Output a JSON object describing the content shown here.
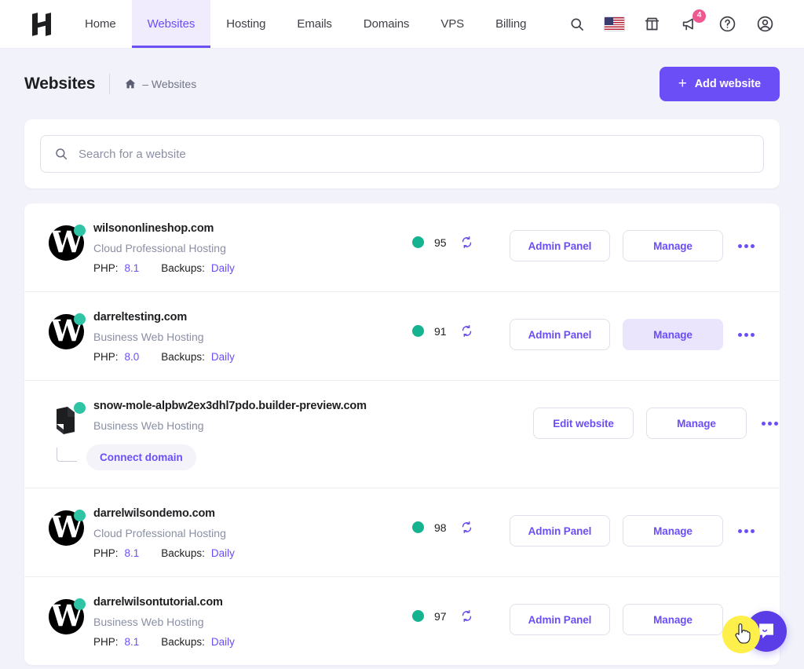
{
  "nav": {
    "logo_name": "hostinger-logo",
    "items": [
      {
        "label": "Home",
        "active": false
      },
      {
        "label": "Websites",
        "active": true
      },
      {
        "label": "Hosting",
        "active": false
      },
      {
        "label": "Emails",
        "active": false
      },
      {
        "label": "Domains",
        "active": false
      },
      {
        "label": "VPS",
        "active": false
      },
      {
        "label": "Billing",
        "active": false
      }
    ],
    "right_icons": [
      {
        "name": "search-icon"
      },
      {
        "name": "flag-us-icon"
      },
      {
        "name": "marketplace-icon"
      },
      {
        "name": "announcements-icon",
        "badge": "4"
      },
      {
        "name": "help-icon"
      },
      {
        "name": "account-icon"
      }
    ],
    "notification_count": "4"
  },
  "header": {
    "title": "Websites",
    "breadcrumb_home_icon": "home-icon",
    "breadcrumb_text": "– Websites",
    "add_button_label": "Add website",
    "add_button_plus": "+"
  },
  "search": {
    "placeholder": "Search for a website",
    "value": "",
    "icon": "search-icon"
  },
  "websites": [
    {
      "name": "wilsononlineshop.com",
      "plan": "Cloud Professional Hosting",
      "icon": "wordpress-icon",
      "php_label": "PHP:",
      "php_value": "8.1",
      "backups_label": "Backups:",
      "backups_value": "Daily",
      "score": "95",
      "status": "online",
      "primary_action": "Admin Panel",
      "secondary_action": "Manage",
      "secondary_hovered": false,
      "connect_domain": null
    },
    {
      "name": "darreltesting.com",
      "plan": "Business Web Hosting",
      "icon": "wordpress-icon",
      "php_label": "PHP:",
      "php_value": "8.0",
      "backups_label": "Backups:",
      "backups_value": "Daily",
      "score": "91",
      "status": "online",
      "primary_action": "Admin Panel",
      "secondary_action": "Manage",
      "secondary_hovered": true,
      "connect_domain": null
    },
    {
      "name": "snow-mole-alpbw2ex3dhl7pdo.builder-preview.com",
      "plan": "Business Web Hosting",
      "icon": "website-builder-icon",
      "php_label": null,
      "php_value": null,
      "backups_label": null,
      "backups_value": null,
      "score": null,
      "status": "online",
      "primary_action": "Edit website",
      "secondary_action": "Manage",
      "secondary_hovered": false,
      "connect_domain": "Connect domain"
    },
    {
      "name": "darrelwilsondemo.com",
      "plan": "Cloud Professional Hosting",
      "icon": "wordpress-icon",
      "php_label": "PHP:",
      "php_value": "8.1",
      "backups_label": "Backups:",
      "backups_value": "Daily",
      "score": "98",
      "status": "online",
      "primary_action": "Admin Panel",
      "secondary_action": "Manage",
      "secondary_hovered": false,
      "connect_domain": null
    },
    {
      "name": "darrelwilsontutorial.com",
      "plan": "Business Web Hosting",
      "icon": "wordpress-icon",
      "php_label": "PHP:",
      "php_value": "8.1",
      "backups_label": "Backups:",
      "backups_value": "Daily",
      "score": "97",
      "status": "online",
      "primary_action": "Admin Panel",
      "secondary_action": "Manage",
      "secondary_hovered": false,
      "connect_domain": null
    }
  ],
  "chat": {
    "icon": "chat-bubble-icon"
  },
  "colors": {
    "accent": "#6c4ef6",
    "page_bg": "#f2f2fb",
    "status_green": "#16b391",
    "badge_pink": "#f0568f",
    "cursor_highlight": "#ffef4a"
  }
}
